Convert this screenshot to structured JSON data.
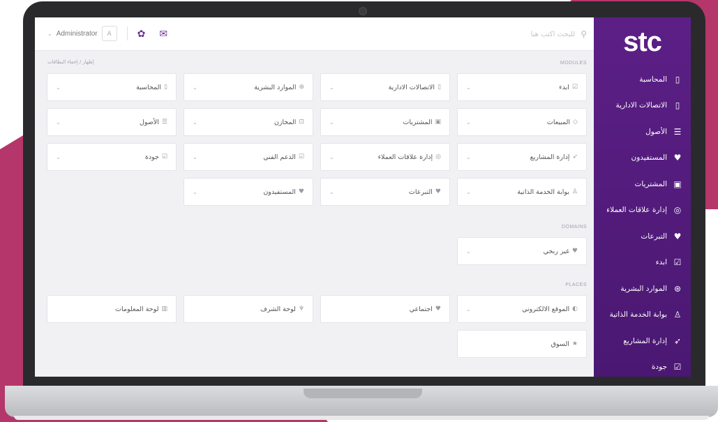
{
  "brand": {
    "logo": "stc",
    "sidebar_color": "#5c1f86",
    "accent": "#b5366b"
  },
  "sidebar": {
    "items": [
      {
        "label": "المحاسبة",
        "icon": "tablet-icon",
        "glyph": "▯"
      },
      {
        "label": "الاتصالات الادارية",
        "icon": "tablet-icon",
        "glyph": "▯"
      },
      {
        "label": "الأصول",
        "icon": "database-icon",
        "glyph": "☰"
      },
      {
        "label": "المستفيدون",
        "icon": "heart-icon",
        "glyph": "♥"
      },
      {
        "label": "المشتريات",
        "icon": "briefcase-icon",
        "glyph": "▣"
      },
      {
        "label": "إدارة علاقات العملاء",
        "icon": "podcast-icon",
        "glyph": "◎"
      },
      {
        "label": "التبرعات",
        "icon": "heart-icon",
        "glyph": "♥"
      },
      {
        "label": "ابدء",
        "icon": "checkbox-icon",
        "glyph": "☑"
      },
      {
        "label": "الموارد البشرية",
        "icon": "users-circle-icon",
        "glyph": "⊛"
      },
      {
        "label": "بوابة الخدمة الذاتية",
        "icon": "person-icon",
        "glyph": "♙"
      },
      {
        "label": "إدارة المشاريع",
        "icon": "rocket-icon",
        "glyph": "➶"
      },
      {
        "label": "جودة",
        "icon": "checkbox-icon",
        "glyph": "☑"
      }
    ]
  },
  "topbar": {
    "search_placeholder": "للبحث اكتب هنا",
    "user_name": "Administrator",
    "avatar_letter": "A",
    "bug_icon": "bug-icon",
    "mail_icon": "mail-icon"
  },
  "breadcrumb": "إظهار / إخفاء البطاقات",
  "sections": {
    "modules": "MODULES",
    "domains": "DOMAINS",
    "places": "PLACES"
  },
  "modules": [
    {
      "label": "ابدء",
      "glyph": "☑",
      "icon": "checkbox-icon"
    },
    {
      "label": "الاتصالات الادارية",
      "glyph": "▯",
      "icon": "tablet-icon"
    },
    {
      "label": "الموارد البشرية",
      "glyph": "⊛",
      "icon": "users-circle-icon"
    },
    {
      "label": "المحاسبة",
      "glyph": "▯",
      "icon": "tablet-icon"
    },
    {
      "label": "المبيعات",
      "glyph": "◇",
      "icon": "tag-icon"
    },
    {
      "label": "المشتريات",
      "glyph": "▣",
      "icon": "briefcase-icon"
    },
    {
      "label": "المخازن",
      "glyph": "⊡",
      "icon": "box-icon"
    },
    {
      "label": "الأصول",
      "glyph": "☰",
      "icon": "database-icon"
    },
    {
      "label": "إدارة المشاريع",
      "glyph": "➶",
      "icon": "rocket-icon"
    },
    {
      "label": "إدارة علاقات العملاء",
      "glyph": "◎",
      "icon": "podcast-icon"
    },
    {
      "label": "الدعم الفني",
      "glyph": "☑",
      "icon": "checkbox-icon"
    },
    {
      "label": "جودة",
      "glyph": "☑",
      "icon": "checkbox-icon"
    },
    {
      "label": "بوابة الخدمة الذاتية",
      "glyph": "♙",
      "icon": "person-icon"
    },
    {
      "label": "التبرعات",
      "glyph": "♥",
      "icon": "heart-icon"
    },
    {
      "label": "المستفيدون",
      "glyph": "♥",
      "icon": "heart-icon"
    }
  ],
  "domains": [
    {
      "label": "غير ربحي",
      "glyph": "♥",
      "icon": "heart-icon"
    }
  ],
  "places": [
    {
      "label": "الموقع الالكتروني",
      "glyph": "◐",
      "icon": "globe-icon",
      "chevron": true
    },
    {
      "label": "اجتماعي",
      "glyph": "♥",
      "icon": "heart-icon",
      "chevron": false
    },
    {
      "label": "لوحة الشرف",
      "glyph": "♆",
      "icon": "trophy-icon",
      "chevron": false
    },
    {
      "label": "لوحة المعلومات",
      "glyph": "▥",
      "icon": "bar-chart-icon",
      "chevron": false
    },
    {
      "label": "السوق",
      "glyph": "★",
      "icon": "star-icon",
      "chevron": false
    }
  ]
}
